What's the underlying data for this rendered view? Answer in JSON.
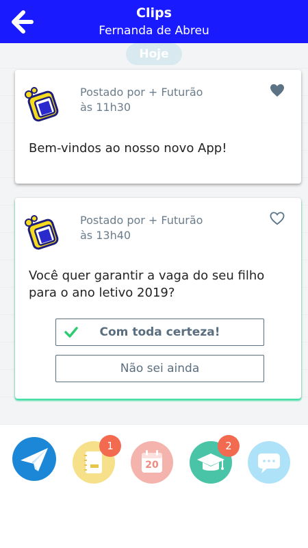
{
  "header": {
    "title": "Clips",
    "subtitle": "Fernanda de Abreu",
    "back_icon": "arrow-left-icon",
    "bg_color": "#1a1aff"
  },
  "feed": {
    "date_label": "Hoje",
    "posts": [
      {
        "posted_by": "Postado por + Futurão",
        "time": "às 11h30",
        "message": "Bem-vindos ao nosso novo App!",
        "liked": true
      },
      {
        "posted_by": "Postado por + Futurão",
        "time": "às 13h40",
        "message": "Você quer garantir a vaga do seu filho para o ano letivo 2019?",
        "liked": false,
        "options": [
          {
            "label": "Com toda certeza!",
            "selected": true
          },
          {
            "label": "Não sei ainda",
            "selected": false
          }
        ]
      }
    ]
  },
  "bottom_nav": {
    "items": [
      {
        "icon": "paper-plane-icon",
        "color": "#1b87d6"
      },
      {
        "icon": "notebook-icon",
        "color": "#f7e08a",
        "badge": "1"
      },
      {
        "icon": "calendar-icon",
        "color": "#f5b3ad",
        "calendar_day": "20"
      },
      {
        "icon": "graduation-cap-icon",
        "color": "#49c4a7",
        "badge": "2"
      },
      {
        "icon": "chat-icon",
        "color": "#aee2f8"
      }
    ]
  }
}
